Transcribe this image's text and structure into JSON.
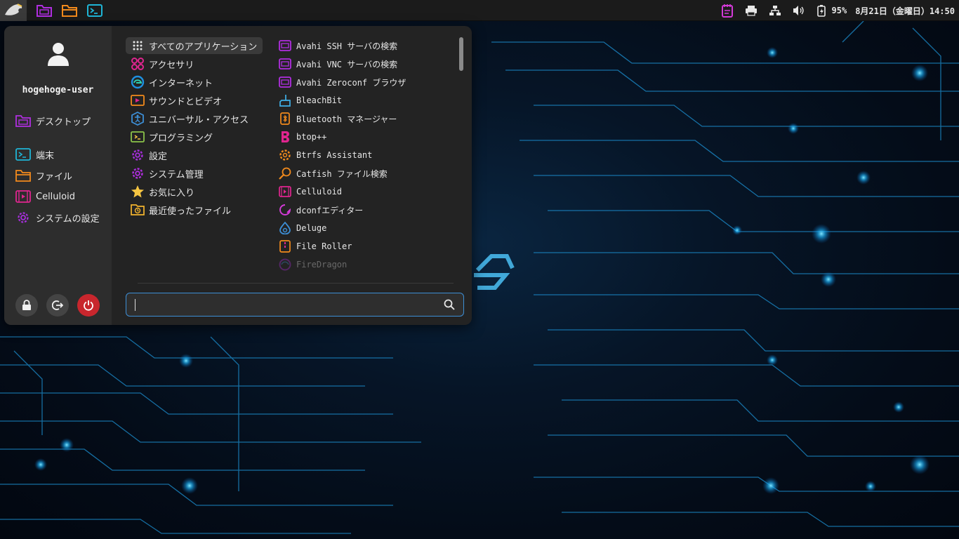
{
  "panel": {
    "launchers": [
      "folder-icon",
      "file-manager-icon",
      "terminal-icon"
    ],
    "battery": "95%",
    "clock": "8月21日（金曜日）14:50"
  },
  "menu": {
    "username": "hogehoge-user",
    "sidebar": [
      {
        "label": "デスクトップ",
        "icon": "desktop-folder-icon"
      },
      {
        "label": "端末",
        "icon": "terminal-icon"
      },
      {
        "label": "ファイル",
        "icon": "folder-icon"
      },
      {
        "label": "Celluloid",
        "icon": "video-player-icon"
      },
      {
        "label": "システムの設定",
        "icon": "settings-gear-icon"
      }
    ],
    "categories": [
      {
        "label": "すべてのアプリケーション",
        "icon": "grid-icon"
      },
      {
        "label": "アクセサリ",
        "icon": "accessories-icon"
      },
      {
        "label": "インターネット",
        "icon": "internet-icon"
      },
      {
        "label": "サウンドとビデオ",
        "icon": "multimedia-icon"
      },
      {
        "label": "ユニバーサル・アクセス",
        "icon": "accessibility-icon"
      },
      {
        "label": "プログラミング",
        "icon": "development-icon"
      },
      {
        "label": "設定",
        "icon": "settings-icon"
      },
      {
        "label": "システム管理",
        "icon": "system-gear-icon"
      },
      {
        "label": "お気に入り",
        "icon": "star-icon"
      },
      {
        "label": "最近使ったファイル",
        "icon": "recent-icon"
      }
    ],
    "apps": [
      {
        "label": "Avahi SSH サーバの検索",
        "icon": "network-window-icon"
      },
      {
        "label": "Avahi VNC サーバの検索",
        "icon": "network-window-icon"
      },
      {
        "label": "Avahi Zeroconf ブラウザ",
        "icon": "network-window-icon"
      },
      {
        "label": "BleachBit",
        "icon": "broom-icon"
      },
      {
        "label": "Bluetooth マネージャー",
        "icon": "bluetooth-icon"
      },
      {
        "label": "btop++",
        "icon": "btop-icon"
      },
      {
        "label": "Btrfs Assistant",
        "icon": "btrfs-gear-icon"
      },
      {
        "label": "Catfish ファイル検索",
        "icon": "search-file-icon"
      },
      {
        "label": "Celluloid",
        "icon": "video-player-icon"
      },
      {
        "label": "dconfエディター",
        "icon": "dconf-icon"
      },
      {
        "label": "Deluge",
        "icon": "deluge-icon"
      },
      {
        "label": "File Roller",
        "icon": "archive-icon"
      },
      {
        "label": "FireDragon",
        "icon": "browser-icon"
      }
    ],
    "search_placeholder": ""
  },
  "colors": {
    "accent": "#3d8fd6",
    "power": "#c8262d",
    "icon_pink": "#e0258f",
    "icon_orange": "#f28a1c",
    "icon_purple": "#9c27d9",
    "icon_cyan": "#1fb5d6"
  }
}
